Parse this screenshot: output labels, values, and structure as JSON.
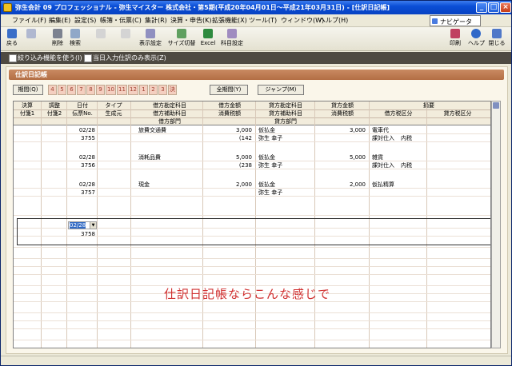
{
  "window": {
    "title": "弥生会計 09 プロフェッショナル - 弥生マイスター 株式会社・第5期(平成20年04月01日～平成21年03月31日) - [仕訳日記帳]"
  },
  "menu": [
    "ファイル(F)",
    "編集(E)",
    "設定(S)",
    "帳簿・伝票(C)",
    "集計(R)",
    "決算・申告(K)",
    "拡張機能(X)",
    "ツール(T)",
    "ウィンドウ(W)",
    "ヘルプ(H)"
  ],
  "navi_label": "ナビゲータ",
  "toolbar": [
    "戻る",
    "",
    "削除",
    "検索",
    "",
    "",
    "表示設定",
    "サイズ切替",
    "Excel",
    "科目設定",
    "印刷",
    "ヘルプ",
    "閉じる"
  ],
  "options": [
    "絞り込み機能を使う(I)",
    "当日入力仕訳のみ表示(Z)"
  ],
  "journal": {
    "title": "仕訳日記帳"
  },
  "period_button": "期間(Q)",
  "months": [
    "4",
    "5",
    "6",
    "7",
    "8",
    "9",
    "10",
    "11",
    "12",
    "1",
    "2",
    "3",
    "決"
  ],
  "all_period_button": "全期間(Y)",
  "jump_button": "ジャンプ(M)",
  "header": {
    "row1": [
      "決算",
      "調整",
      "日付",
      "タイプ",
      "借方勘定科目",
      "借方金額",
      "貸方勘定科目",
      "貸方金額",
      "摘要"
    ],
    "row2": [
      "付箋1",
      "付箋2",
      "伝票No.",
      "生成元",
      "借方補助科目",
      "消費税額",
      "貸方補助科目",
      "消費税額",
      "借方税区分",
      "貸方税区分"
    ],
    "row3": [
      "借方部門",
      "貸方部門"
    ]
  },
  "entries": [
    {
      "date": "02/28",
      "no": "3755",
      "debit": "旅費交通費",
      "debit_amount": "3,000",
      "debit_tax": "(142",
      "credit": "仮払金",
      "credit_sub": "弥生 幸子",
      "credit_amount": "3,000",
      "memo": "電車代",
      "tax": "課対仕入",
      "tax2": "内税"
    },
    {
      "date": "02/28",
      "no": "3756",
      "debit": "消耗品費",
      "debit_amount": "5,000",
      "debit_tax": "(238",
      "credit": "仮払金",
      "credit_sub": "弥生 幸子",
      "credit_amount": "5,000",
      "memo": "雑貨",
      "tax": "課対仕入",
      "tax2": "内税"
    },
    {
      "date": "02/28",
      "no": "3757",
      "debit": "現金",
      "debit_amount": "2,000",
      "debit_tax": "",
      "credit": "仮払金",
      "credit_sub": "弥生 幸子",
      "credit_amount": "2,000",
      "memo": "仮払精算",
      "tax": "",
      "tax2": ""
    }
  ],
  "new_entry": {
    "date": "02/28",
    "no": "3758"
  },
  "annotation": "仕訳日記帳ならこんな感じで"
}
